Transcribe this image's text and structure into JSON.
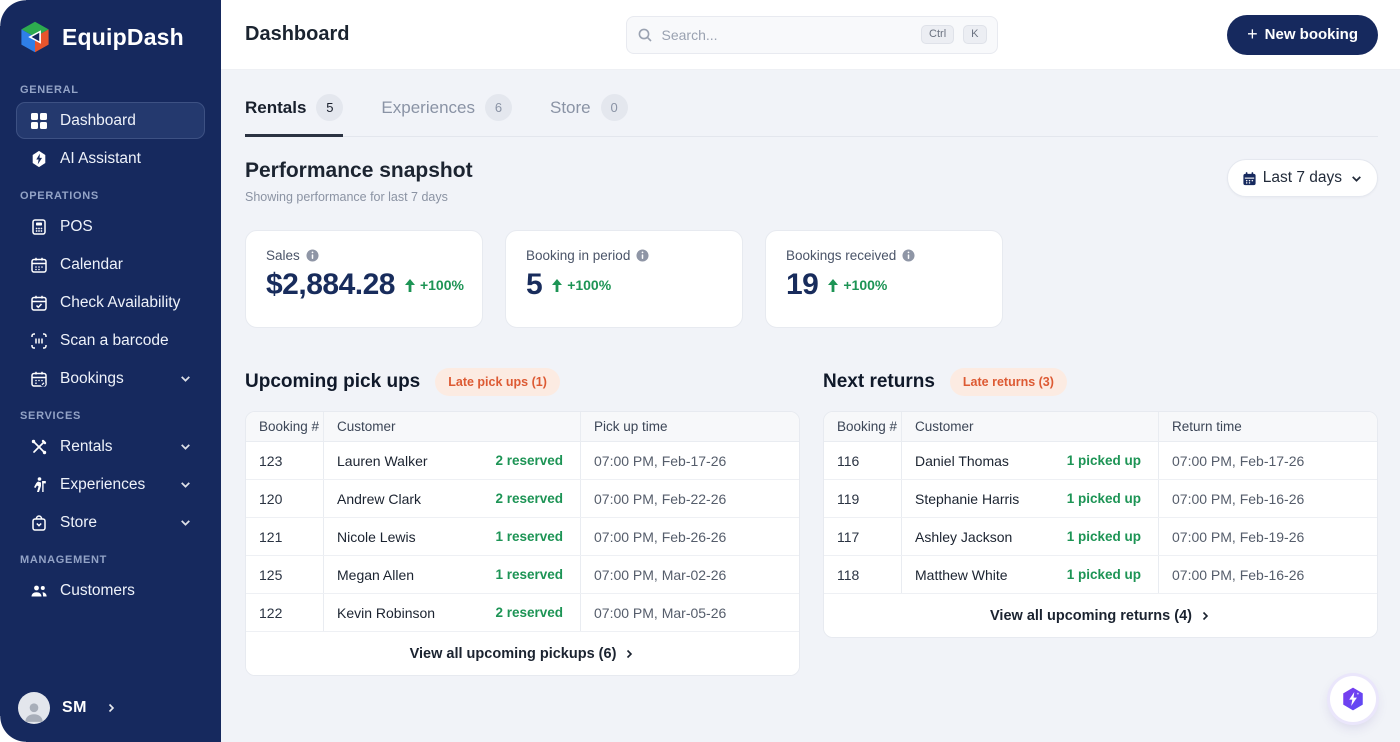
{
  "brand": {
    "name": "EquipDash"
  },
  "sidebar": {
    "sections": [
      {
        "label": "GENERAL",
        "items": [
          {
            "label": "Dashboard",
            "active": true
          },
          {
            "label": "AI Assistant"
          }
        ]
      },
      {
        "label": "OPERATIONS",
        "items": [
          {
            "label": "POS"
          },
          {
            "label": "Calendar"
          },
          {
            "label": "Check Availability"
          },
          {
            "label": "Scan a barcode"
          },
          {
            "label": "Bookings"
          }
        ]
      },
      {
        "label": "SERVICES",
        "items": [
          {
            "label": "Rentals"
          },
          {
            "label": "Experiences"
          },
          {
            "label": "Store"
          }
        ]
      },
      {
        "label": "MANAGEMENT",
        "items": [
          {
            "label": "Customers"
          }
        ]
      }
    ],
    "user": {
      "initials": "SM"
    }
  },
  "header": {
    "title": "Dashboard",
    "search": {
      "placeholder": "Search...",
      "keys": [
        "Ctrl",
        "K"
      ]
    },
    "new_booking_label": "New booking"
  },
  "tabs": [
    {
      "label": "Rentals",
      "count": "5",
      "active": true
    },
    {
      "label": "Experiences",
      "count": "6",
      "active": false
    },
    {
      "label": "Store",
      "count": "0",
      "active": false
    }
  ],
  "performance": {
    "title": "Performance snapshot",
    "subtitle": "Showing performance for last 7 days",
    "range_label": "Last 7 days"
  },
  "stats": [
    {
      "label": "Sales",
      "value": "$2,884.28",
      "change": "+100%"
    },
    {
      "label": "Booking in period",
      "value": "5",
      "change": "+100%"
    },
    {
      "label": "Bookings received",
      "value": "19",
      "change": "+100%"
    }
  ],
  "pickups": {
    "title": "Upcoming pick ups",
    "badge": "Late pick ups (1)",
    "columns": {
      "booking": "Booking #",
      "customer": "Customer",
      "time": "Pick up time"
    },
    "rows": [
      {
        "booking": "123",
        "customer": "Lauren Walker",
        "status": "2 reserved",
        "time": "07:00 PM, Feb-17-26"
      },
      {
        "booking": "120",
        "customer": "Andrew Clark",
        "status": "2 reserved",
        "time": "07:00 PM, Feb-22-26"
      },
      {
        "booking": "121",
        "customer": "Nicole Lewis",
        "status": "1 reserved",
        "time": "07:00 PM, Feb-26-26"
      },
      {
        "booking": "125",
        "customer": "Megan Allen",
        "status": "1 reserved",
        "time": "07:00 PM, Mar-02-26"
      },
      {
        "booking": "122",
        "customer": "Kevin Robinson",
        "status": "2 reserved",
        "time": "07:00 PM, Mar-05-26"
      }
    ],
    "footer": "View all upcoming pickups (6)"
  },
  "returns": {
    "title": "Next returns",
    "badge": "Late returns (3)",
    "columns": {
      "booking": "Booking #",
      "customer": "Customer",
      "time": "Return time"
    },
    "rows": [
      {
        "booking": "116",
        "customer": "Daniel Thomas",
        "status": "1 picked up",
        "time": "07:00 PM, Feb-17-26"
      },
      {
        "booking": "119",
        "customer": "Stephanie Harris",
        "status": "1 picked up",
        "time": "07:00 PM, Feb-16-26"
      },
      {
        "booking": "117",
        "customer": "Ashley Jackson",
        "status": "1 picked up",
        "time": "07:00 PM, Feb-19-26"
      },
      {
        "booking": "118",
        "customer": "Matthew White",
        "status": "1 picked up",
        "time": "07:00 PM, Feb-16-26"
      }
    ],
    "footer": "View all upcoming returns (4)"
  },
  "colors": {
    "sidebar_navy": "#16295e",
    "accent_navy": "#182c5c",
    "positive_green": "#1d9455",
    "late_badge_bg": "#fcebe2",
    "late_badge_text": "#dd5a33",
    "fab_purple": "#7c3aed",
    "content_bg": "#f1f3f8"
  }
}
